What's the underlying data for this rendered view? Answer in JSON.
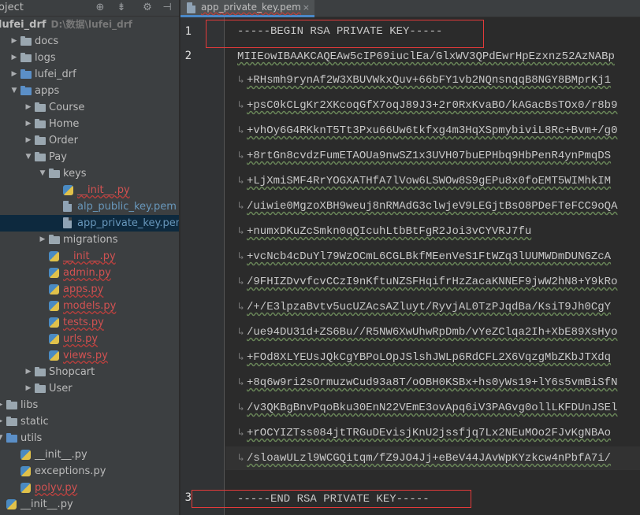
{
  "project_panel": {
    "header_title": "oject",
    "globe_icon": "⊕",
    "collapse_icon": "⇟",
    "settings_icon": "⚙",
    "hide_icon": "⊣",
    "root": {
      "label": "lufei_drf",
      "path_hint": "D:\\数据\\lufei_drf"
    },
    "tree": [
      {
        "label": "docs",
        "kind": "folder"
      },
      {
        "label": "logs",
        "kind": "folder"
      },
      {
        "label": "lufei_drf",
        "kind": "folder"
      },
      {
        "label": "apps",
        "kind": "folder-open"
      },
      {
        "label": "Course",
        "kind": "folder"
      },
      {
        "label": "Home",
        "kind": "folder"
      },
      {
        "label": "Order",
        "kind": "folder"
      },
      {
        "label": "Pay",
        "kind": "folder-open"
      },
      {
        "label": "keys",
        "kind": "folder-open"
      },
      {
        "label": "__init__.py",
        "kind": "py-err"
      },
      {
        "label": "alp_public_key.pem",
        "kind": "pem"
      },
      {
        "label": "app_private_key.pem",
        "kind": "pem-selected"
      },
      {
        "label": "migrations",
        "kind": "folder"
      },
      {
        "label": "__init__.py",
        "kind": "py-err"
      },
      {
        "label": "admin.py",
        "kind": "py-err"
      },
      {
        "label": "apps.py",
        "kind": "py-err"
      },
      {
        "label": "models.py",
        "kind": "py-err"
      },
      {
        "label": "tests.py",
        "kind": "py-err"
      },
      {
        "label": "urls.py",
        "kind": "py-err"
      },
      {
        "label": "views.py",
        "kind": "py-err"
      },
      {
        "label": "Shopcart",
        "kind": "folder"
      },
      {
        "label": "User",
        "kind": "folder"
      },
      {
        "label": "libs",
        "kind": "folder"
      },
      {
        "label": "static",
        "kind": "folder"
      },
      {
        "label": "utils",
        "kind": "folder-open"
      },
      {
        "label": "__init__.py",
        "kind": "py"
      },
      {
        "label": "exceptions.py",
        "kind": "py"
      },
      {
        "label": "polyv.py",
        "kind": "py-err"
      },
      {
        "label": "__init__.py",
        "kind": "py"
      }
    ]
  },
  "editor": {
    "tab_label": "app_private_key.pem",
    "tab_close": "×",
    "line_numbers": [
      "1",
      "2",
      "3"
    ],
    "wrap_marker": "↳",
    "lines": {
      "begin": "-----BEGIN RSA PRIVATE KEY-----",
      "first": "MIIEowIBAAKCAQEAw5cIP69iuclEa/GlxWV3QPdEwrHpEzxnz52AzNABp",
      "wrapped": [
        "+RHsmh9rynAf2W3XBUVWkxQuv+66bFY1vb2NQnsnqqB8NGY8BMprKj1",
        "+psC0kCLgKr2XKcoqGfX7oqJ89J3+2r0RxKvaBO/kAGacBsTOx0/r8b9",
        "+vhOy6G4RKknT5Tt3Pxu66Uw6tkfxg4m3HqXSpmybiviL8Rc+Bvm+/g0",
        "+8rtGn8cvdzFumETAOUa9nwSZ1x3UVH07buEPHbq9HbPenR4ynPmqDS",
        "+LjXmiSMF4RrYOGXATHfA7lVow6LSWOw8S9gEPu8x0foEMT5WIMhkIM",
        "/uiwie0MgzoXBH9weuj8nRMAdG3clwjeV9LEGjtBsO8PDeFTeFCC9oQA",
        "+numxDKuZcSmkn0qQIcuhLtbBtFgR2Joi3vCYVRJ7fu",
        "+vcNcb4cDuYl79WzOCmL6CGLBkfMEenVeS1FtWZq3lUUMWDmDUNGZcA",
        "/9FHIZDvvfcvCCzI9nKftuNZSFHqifrHzZacaKNNEF9jwW2hN8+Y9kRo",
        "/+/E3lpzaBvtv5ucUZAcsAZluyt/RyvjAL0TzPJqdBa/KsiT9Jh0CgY",
        "/ue94DU31d+ZS6Bu//R5NW6XwUhwRpDmb/vYeZClqa2Ih+XbE89XsHyo",
        "+FOd8XLYEUsJQkCgYBPoLOpJSlshJWLp6RdCFL2X6VqzgMbZKbJTXdq",
        "+8q6w9ri2sOrmuzwCud93a8T/oOBH0KSBx+hs0yWs19+lY6s5vmBiSfN",
        "/v3QKBgBnvPqoBku30EnN22VEmE3ovApq6iV3PAGvg0ollLKFDUnJSEl",
        "+rOCYIZTss084jtTRGuDEvisjKnU2jssfjq7Lx2NEuMOo2FJvKgNBAo",
        "/sloawULzl9WCGQitqm/fZ9JO4Jj+eBeV44JAvWpKYzkcw4nPbfA7i/"
      ],
      "end": "-----END RSA PRIVATE KEY-----"
    }
  }
}
